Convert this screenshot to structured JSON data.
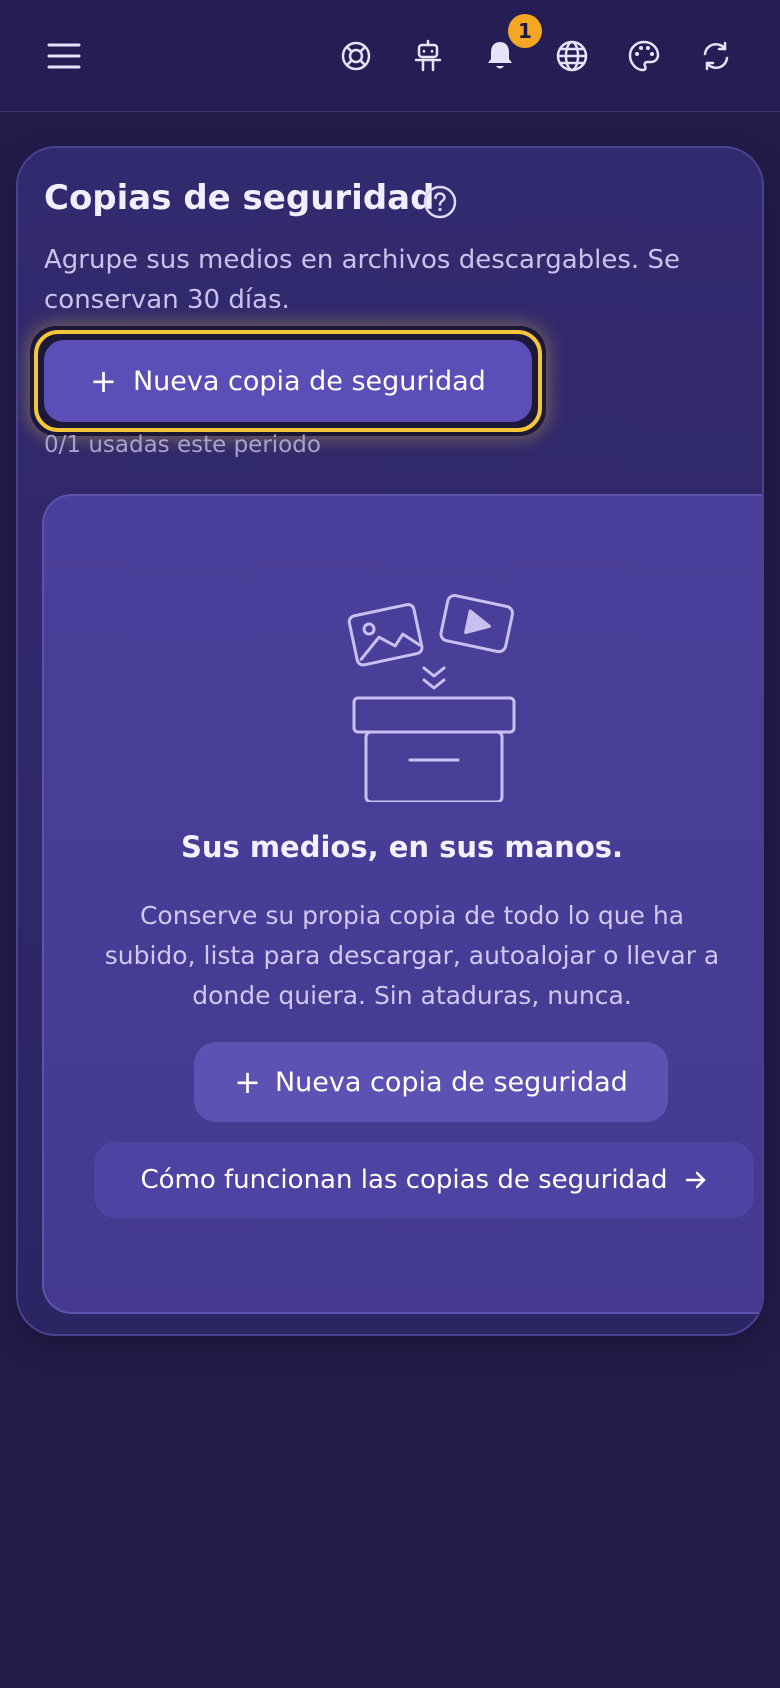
{
  "topbar": {
    "icons": [
      "menu-icon",
      "lifebuoy-icon",
      "robot-icon",
      "bell-icon",
      "globe-icon",
      "palette-icon",
      "refresh-icon"
    ],
    "notification_count": "1",
    "badge_color": "#f5a623"
  },
  "section": {
    "title": "Copias de seguridad",
    "subtitle": "Agrupe sus medios en archivos descargables. Se conservan 30 días.",
    "primary_button_label": "Nueva copia de seguridad",
    "usage_text": "0/1 usadas este periodo",
    "focus_ring_color": "#f3c737"
  },
  "empty_state": {
    "illustration": "archive-box-media-icon",
    "title": "Sus medios, en sus manos.",
    "body": "Conserve su propia copia de todo lo que ha subido, lista para descargar, autoalojar o llevar a donde quiera. Sin ataduras, nunca.",
    "button_label": "Nueva copia de seguridad",
    "link_label": "Cómo funcionan las copias de seguridad"
  },
  "colors": {
    "background": "#221c4a",
    "card": "#322a6e",
    "primary_button": "#5b4fb7",
    "panel": "#4a3f9a"
  }
}
